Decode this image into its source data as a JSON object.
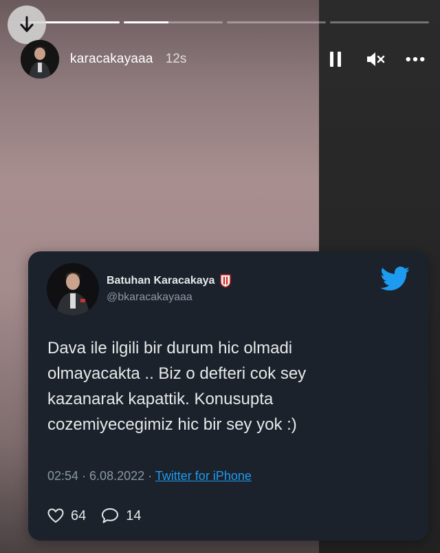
{
  "story": {
    "username": "karacakayaaa",
    "time_ago": "12s",
    "progress": [
      1.0,
      0.45,
      0.0,
      0.0
    ]
  },
  "tweet": {
    "name": "Batuhan Karacakaya",
    "handle": "@bkaracakayaaa",
    "text": "Dava ile ilgili bir durum hic olmadi\nolmayacakta .. Biz o defteri cok sey\nkazanarak kapattik. Konusupta\ncozemiyecegimiz hic bir sey yok :)",
    "date": "02:54 · 6.08.2022 · ",
    "source": "Twitter for iPhone",
    "likes": "64",
    "replies": "14"
  },
  "icons": {
    "download": "download-icon",
    "pause": "pause-icon",
    "mute": "mute-icon",
    "more": "more-icon",
    "bird": "twitter-bird-icon",
    "like": "heart-icon",
    "reply": "reply-icon"
  },
  "colors": {
    "card_bg": "#1b222b",
    "link": "#1d9bf0",
    "twitter_blue": "#1d9bf0"
  }
}
